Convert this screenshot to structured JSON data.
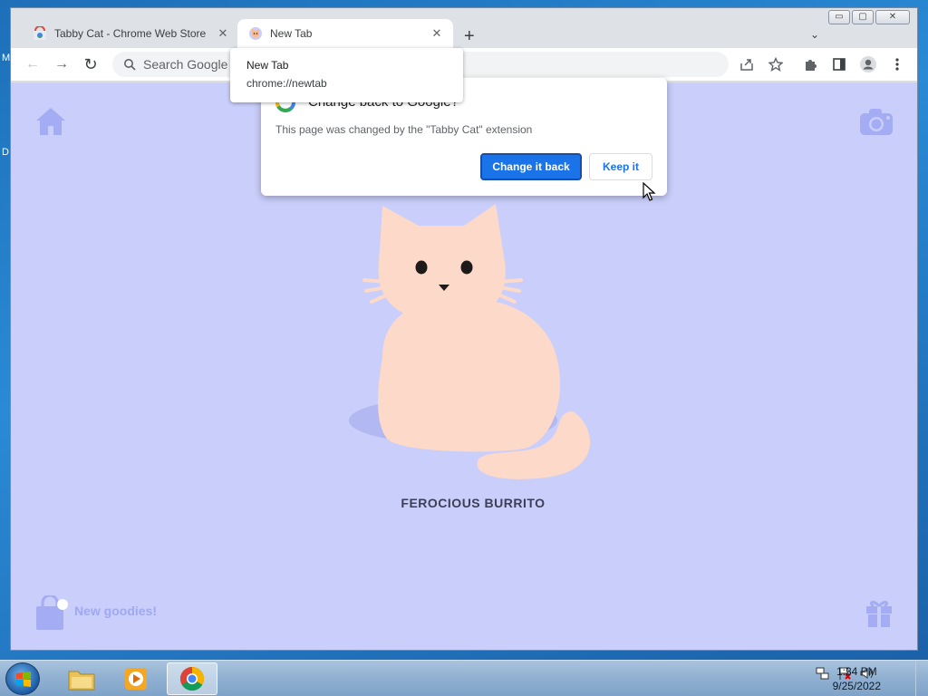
{
  "desktop": {
    "edge_letters": [
      "M",
      "D"
    ]
  },
  "window": {
    "controls": {
      "minimize": "▭",
      "maximize": "▢",
      "close": "✕"
    }
  },
  "tabs": [
    {
      "title": "Tabby Cat - Chrome Web Store",
      "close": "✕",
      "icon": "chrome-web-store-icon"
    },
    {
      "title": "New Tab",
      "close": "✕",
      "icon": "tabby-cat-icon"
    }
  ],
  "tabstrip": {
    "new_tab": "+",
    "tab_search": "⌄"
  },
  "toolbar": {
    "back": "←",
    "forward": "→",
    "reload": "↻",
    "omnibox_placeholder": "Search Google or type a URL",
    "omnibox_visible": "Search Google c"
  },
  "hover_card": {
    "title": "New Tab",
    "url": "chrome://newtab"
  },
  "bubble": {
    "title": "Change back to Google?",
    "body": "This page was changed by the \"Tabby Cat\" extension",
    "primary_button": "Change it back",
    "secondary_button": "Keep it"
  },
  "page": {
    "cat_name": "FEROCIOUS BURRITO",
    "goodies_label": "New goodies!",
    "colors": {
      "background": "#c9cefa",
      "cat": "#fcd9c8",
      "accent": "#a0a8f2"
    }
  },
  "taskbar": {
    "time": "1:34 PM",
    "date": "9/25/2022"
  }
}
